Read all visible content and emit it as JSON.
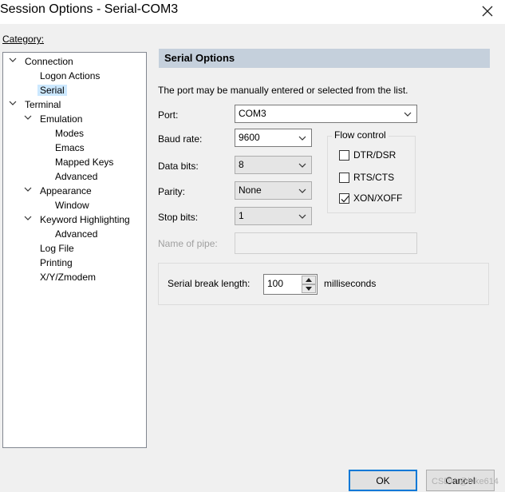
{
  "window": {
    "title": "Session Options - Serial-COM3",
    "close_glyph": "✕"
  },
  "category": {
    "label": "Category:",
    "items": [
      {
        "label": "Connection",
        "expanded": true
      },
      {
        "label": "Logon Actions"
      },
      {
        "label": "Serial",
        "selected": true
      },
      {
        "label": "Terminal",
        "expanded": true
      },
      {
        "label": "Emulation",
        "expanded": true
      },
      {
        "label": "Modes"
      },
      {
        "label": "Emacs"
      },
      {
        "label": "Mapped Keys"
      },
      {
        "label": "Advanced"
      },
      {
        "label": "Appearance",
        "expanded": true
      },
      {
        "label": "Window"
      },
      {
        "label": "Keyword Highlighting",
        "expanded": true
      },
      {
        "label": "Advanced"
      },
      {
        "label": "Log File"
      },
      {
        "label": "Printing"
      },
      {
        "label": "X/Y/Zmodem"
      }
    ]
  },
  "panel": {
    "header": "Serial Options",
    "description": "The port may be manually entered or selected from the list.",
    "port": {
      "label": "Port:",
      "value": "COM3"
    },
    "baud_rate": {
      "label": "Baud rate:",
      "value": "9600"
    },
    "data_bits": {
      "label": "Data bits:",
      "value": "8"
    },
    "parity": {
      "label": "Parity:",
      "value": "None"
    },
    "stop_bits": {
      "label": "Stop bits:",
      "value": "1"
    },
    "pipe": {
      "label": "Name of pipe:",
      "value": ""
    },
    "flow_control": {
      "legend": "Flow control",
      "dtr_dsr": {
        "label": "DTR/DSR",
        "checked": false
      },
      "rts_cts": {
        "label": "RTS/CTS",
        "checked": false
      },
      "xon_xoff": {
        "label": "XON/XOFF",
        "checked": true
      }
    },
    "serial_break": {
      "label": "Serial break length:",
      "value": "100",
      "unit": "milliseconds"
    }
  },
  "buttons": {
    "ok": "OK",
    "cancel": "Cancel"
  },
  "watermark": "CSDN @hike614",
  "colors": {
    "header_bg": "#c5d0dc",
    "selection": "#cce8ff",
    "default_button_border": "#0078d7"
  }
}
